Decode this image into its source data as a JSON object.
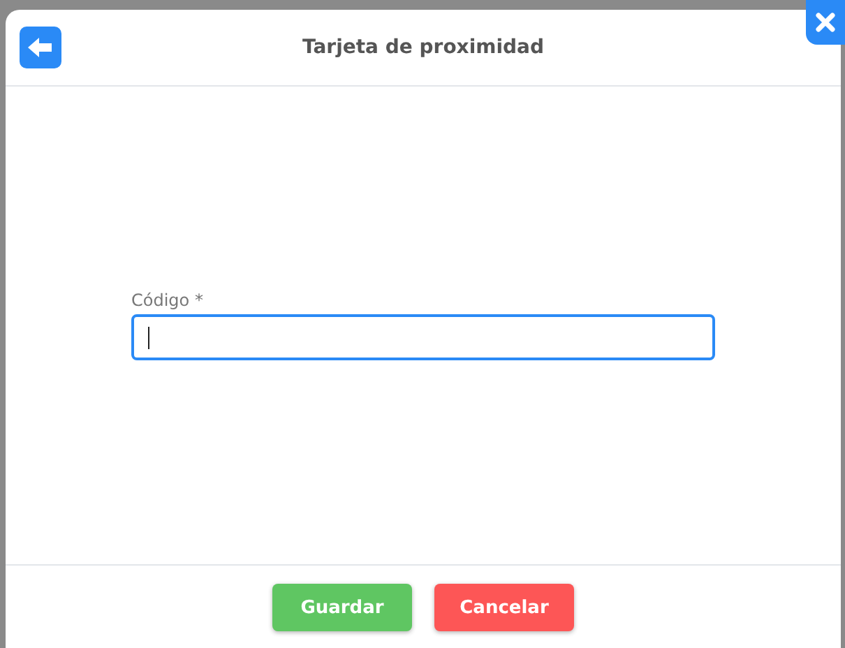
{
  "dialog": {
    "title": "Tarjeta de proximidad"
  },
  "field": {
    "label": "Código *",
    "focused": true
  },
  "buttons": [
    {
      "label": "Guardar",
      "kind": "confirm"
    },
    {
      "label": "Cancelar",
      "kind": "cancel"
    }
  ]
}
